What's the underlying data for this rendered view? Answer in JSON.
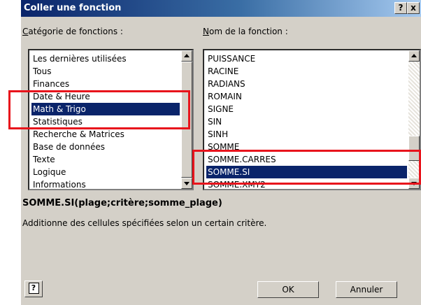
{
  "window": {
    "title": "Coller une fonction",
    "help_button": "?",
    "close_button": "x"
  },
  "category": {
    "label_accel": "C",
    "label_rest": "atégorie de fonctions :",
    "items": [
      "Les dernières utilisées",
      "Tous",
      "Finances",
      "Date & Heure",
      "Math & Trigo",
      "Statistiques",
      "Recherche & Matrices",
      "Base de données",
      "Texte",
      "Logique",
      "Informations"
    ],
    "selected": "Math & Trigo"
  },
  "function_name": {
    "label_accel": "N",
    "label_rest": "om de la fonction :",
    "items": [
      "PUISSANCE",
      "RACINE",
      "RADIANS",
      "ROMAIN",
      "SIGNE",
      "SIN",
      "SINH",
      "SOMME",
      "SOMME.CARRES",
      "SOMME.SI",
      "SOMME.XMY2"
    ],
    "selected": "SOMME.SI"
  },
  "signature": "SOMME.SI(plage;critère;somme_plage)",
  "description": "Additionne des cellules spécifiées selon un certain critère.",
  "buttons": {
    "ok": "OK",
    "cancel": "Annuler",
    "help": "?"
  },
  "annotation": {
    "color": "#e8141c"
  }
}
